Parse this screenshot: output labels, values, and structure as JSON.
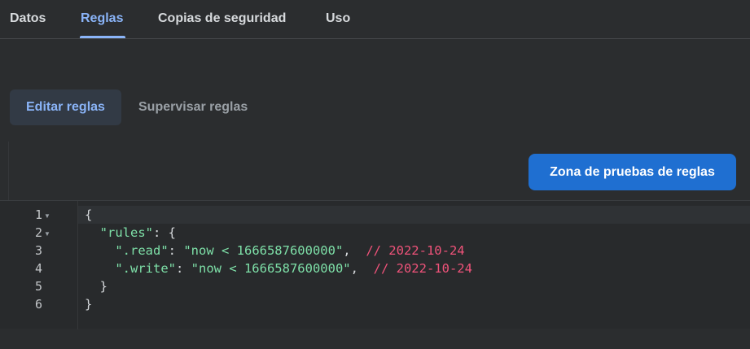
{
  "tabs": [
    {
      "label": "Datos"
    },
    {
      "label": "Reglas"
    },
    {
      "label": "Copias de seguridad"
    },
    {
      "label": "Uso"
    }
  ],
  "active_tab": "Reglas",
  "subtabs": [
    {
      "label": "Editar reglas"
    },
    {
      "label": "Supervisar reglas"
    }
  ],
  "sandbox_button": {
    "label": "Zona de pruebas de reglas"
  },
  "editor": {
    "line_numbers": [
      "1",
      "2",
      "3",
      "4",
      "5",
      "6"
    ],
    "lines": {
      "l1": {
        "brace": "{"
      },
      "l2": {
        "key": "\"rules\"",
        "sep": ": {"
      },
      "l3": {
        "key": "\".read\"",
        "sep": ": ",
        "value": "\"now < 1666587600000\"",
        "comma": ",",
        "comment": "// 2022-10-24"
      },
      "l4": {
        "key": "\".write\"",
        "sep": ": ",
        "value": "\"now < 1666587600000\"",
        "comma": ",",
        "comment": "// 2022-10-24"
      },
      "l5": {
        "brace": "}"
      },
      "l6": {
        "brace": "}"
      }
    }
  },
  "colors": {
    "accent": "#8ab4f8",
    "button": "#1f6fd1",
    "string": "#7ee0a8",
    "comment": "#f0537a"
  }
}
